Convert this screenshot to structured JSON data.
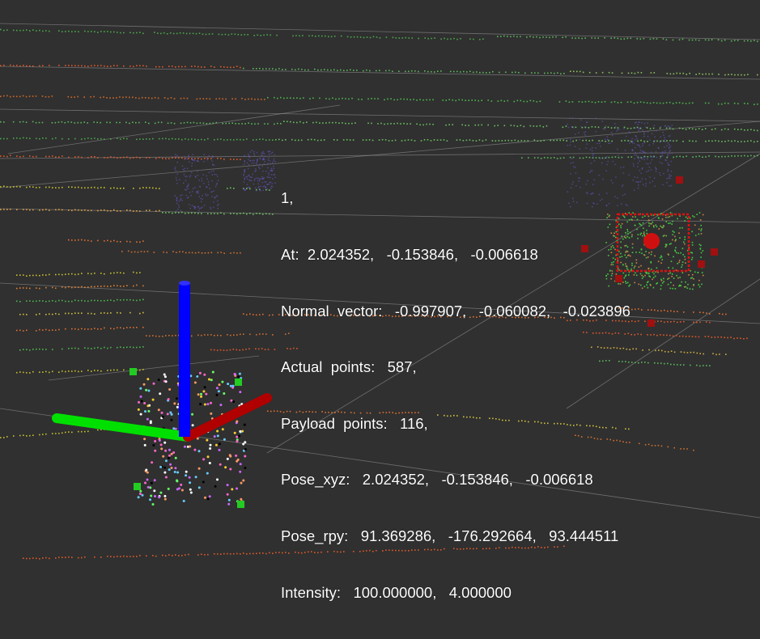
{
  "viewer": {
    "background_color": "#303030",
    "grid_color": "#a0a0a0"
  },
  "axes": {
    "x_color": "#b00000",
    "y_color": "#00e000",
    "z_color": "#0000ff"
  },
  "overlay_lines": [
    "1,",
    "At:  2.024352,   -0.153846,   -0.006618",
    "Normal  vector:   -0.997907,   -0.060082,   -0.023896",
    "Actual  points:   587,",
    "Payload  points:   116,",
    "Pose_xyz:   2.024352,   -0.153846,   -0.006618",
    "Pose_rpy:   91.369286,   -176.292664,   93.444511",
    "Intensity:   100.000000,   4.000000"
  ]
}
